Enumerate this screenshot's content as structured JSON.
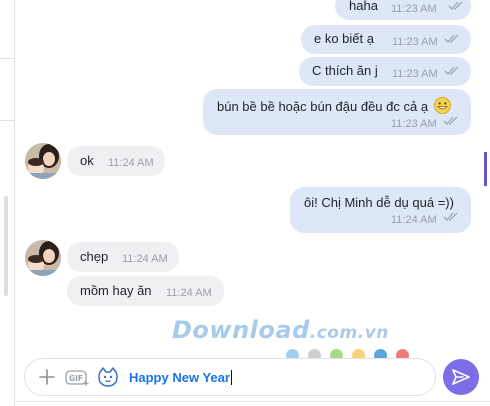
{
  "messages": [
    {
      "type": "sent",
      "text": "haha",
      "time": "11:23 AM"
    },
    {
      "type": "sent",
      "text": "e ko biết ạ",
      "time": "11:23 AM"
    },
    {
      "type": "sent",
      "text": "C thích ăn j",
      "time": "11:23 AM"
    },
    {
      "type": "sent",
      "text": "bún bề bề hoặc bún đậu đều đc cả ạ",
      "time": "11:23 AM",
      "emoji": "grinning-face-icon"
    },
    {
      "type": "received",
      "text": "ok",
      "time": "11:24 AM"
    },
    {
      "type": "sent",
      "text": "ôi! Chị Minh dễ dụ quá =))",
      "time": "11:24 AM"
    },
    {
      "type": "received",
      "text": "chẹp",
      "time": "11:24 AM"
    },
    {
      "type": "received",
      "text": "mồm hay ăn",
      "time": "11:24 AM"
    }
  ],
  "watermark": {
    "main": "Download",
    "suffix": ".com.vn"
  },
  "reaction_colors": [
    "#9fd0f0",
    "#cfcfd2",
    "#a8d98a",
    "#f7d27a",
    "#5aa6dc",
    "#f07b7b"
  ],
  "composer": {
    "text": "Happy New Year",
    "icons": [
      "plus-icon",
      "gif-icon",
      "sticker-icon"
    ]
  },
  "send_button": {
    "icon": "send-icon",
    "color": "#7b6ee6"
  },
  "colors": {
    "sent_bubble": "#dde7f7",
    "received_bubble": "#f0f0f2",
    "accent": "#7b6ee6"
  }
}
